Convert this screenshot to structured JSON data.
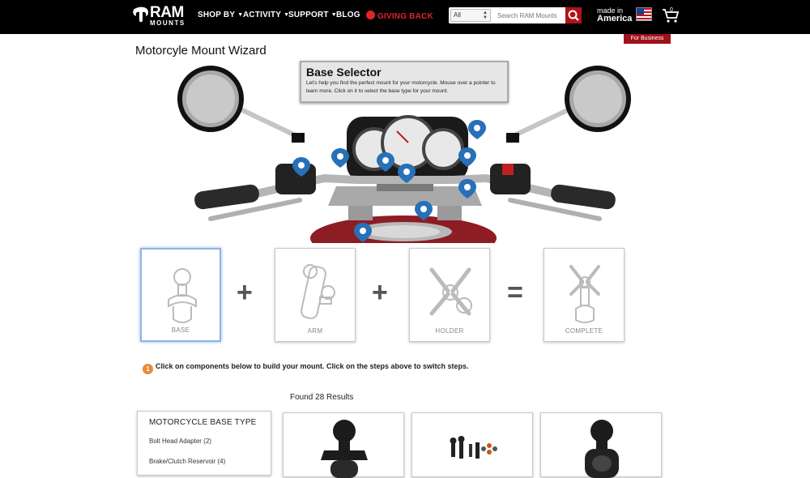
{
  "brand": {
    "logo_text": "RAM",
    "logo_sub": "MOUNTS"
  },
  "nav": {
    "items": [
      "SHOP BY",
      "ACTIVITY",
      "SUPPORT",
      "BLOG"
    ],
    "giving_back": "GIVING BACK"
  },
  "search": {
    "scope": "All",
    "placeholder": "Search RAM Mounts"
  },
  "made_in": {
    "line1": "made in",
    "line2": "America"
  },
  "cart": {
    "count": "0"
  },
  "for_business": "For Business",
  "page_title": "Motorcyle Mount Wizard",
  "tooltip": {
    "title": "Base Selector",
    "text": "Let's help you find the perfect mount for your motorcycle. Mouse over a pointer to learn more. Click on it to select the base type for your mount."
  },
  "steps": [
    {
      "label": "BASE",
      "active": true
    },
    {
      "label": "ARM",
      "active": false
    },
    {
      "label": "HOLDER",
      "active": false
    },
    {
      "label": "COMPLETE",
      "active": false
    }
  ],
  "operators": [
    "+",
    "+",
    "="
  ],
  "hint": {
    "number": "1",
    "text": "Click on components below to build your mount. Click on the steps above to switch steps."
  },
  "results": {
    "found": "Found 28 Results"
  },
  "filter": {
    "title": "MOTORCYCLE BASE TYPE",
    "items": [
      "Bolt Head Adapter (2)",
      "Brake/Clutch Reservoir (4)"
    ]
  },
  "colors": {
    "topbar": "#000000",
    "accent_red": "#b0121b",
    "pin_blue": "#2870b8",
    "active_step_border": "#8cb3e6"
  }
}
